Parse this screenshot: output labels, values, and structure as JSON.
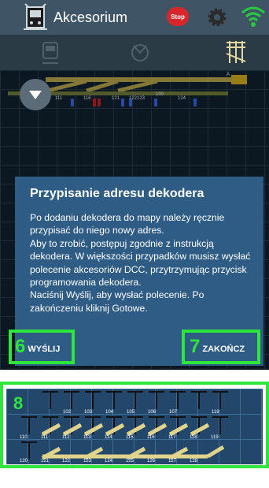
{
  "header": {
    "title": "Akcesorium",
    "stop_label": "Stop",
    "icons": [
      "app-logo-icon",
      "stop-icon",
      "gear-icon",
      "wifi-icon"
    ]
  },
  "toolbar": {
    "icons": [
      "train-icon",
      "accessory-icon",
      "track-icon"
    ]
  },
  "track": {
    "labels": [
      "111",
      "116",
      "121",
      "122",
      "123",
      "100",
      "124",
      "A"
    ]
  },
  "dialog": {
    "title": "Przypisanie adresu dekodera",
    "body": "Po dodaniu dekodera do mapy należy ręcznie przypisać do niego nowy adres.\n Aby to zrobić, postępuj zgodnie z instrukcją dekodera. W większości przypadków musisz wysłać polecenie akcesoriów DCC, przytrzymując przycisk programowania dekodera.\n Naciśnij Wyślij, aby wysłać polecenie. Po zakończeniu kliknij Gotowe.",
    "send_number": "6",
    "send_label": "WYŚLIJ",
    "end_number": "7",
    "end_label": "ZAKOŃCZ"
  },
  "palette": {
    "number": "8",
    "row1_labels": [
      "102",
      "103",
      "104",
      "105",
      "106",
      "107",
      "118"
    ],
    "row2_labels": [
      "110",
      "111",
      "112",
      "113",
      "114",
      "115",
      "116",
      "117",
      "118",
      "119"
    ],
    "row3_labels": [
      "120",
      "121",
      "122",
      "123",
      "124",
      "125",
      "126",
      "127",
      "128"
    ]
  },
  "colors": {
    "highlight": "#2ee63c",
    "dialog": "#2e5c84",
    "topbar": "#3f5566"
  }
}
